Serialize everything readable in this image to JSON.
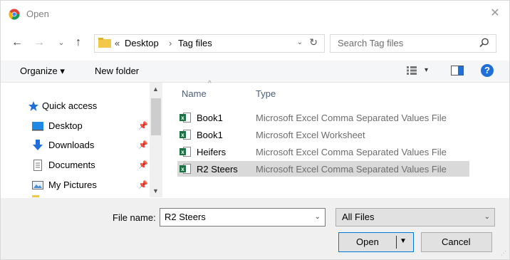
{
  "window": {
    "title": "Open",
    "close_glyph": "✕"
  },
  "nav": {
    "back": "←",
    "forward": "→",
    "recent": "⌄",
    "up": "↑"
  },
  "address": {
    "prefix": "«",
    "crumbs": [
      "Desktop",
      "Tag files"
    ],
    "separator": "›",
    "dropdown": "⌄",
    "refresh": "↻"
  },
  "search": {
    "placeholder": "Search Tag files"
  },
  "toolbar": {
    "organize": "Organize ▾",
    "new_folder": "New folder",
    "view_drop": "▾",
    "help": "?"
  },
  "sidebar": {
    "items": [
      {
        "label": "Quick access",
        "icon": "star-icon"
      },
      {
        "label": "Desktop",
        "icon": "desktop-icon",
        "pinned": true
      },
      {
        "label": "Downloads",
        "icon": "download-icon",
        "pinned": true
      },
      {
        "label": "Documents",
        "icon": "documents-icon",
        "pinned": true
      },
      {
        "label": "My Pictures",
        "icon": "pictures-icon",
        "pinned": true
      }
    ],
    "pin_glyph": "📌"
  },
  "filelist": {
    "columns": {
      "name": "Name",
      "type": "Type"
    },
    "rows": [
      {
        "name": "Book1",
        "type": "Microsoft Excel Comma Separated Values File",
        "selected": false
      },
      {
        "name": "Book1",
        "type": "Microsoft Excel Worksheet",
        "selected": false
      },
      {
        "name": "Heifers",
        "type": "Microsoft Excel Comma Separated Values File",
        "selected": false
      },
      {
        "name": "R2 Steers",
        "type": "Microsoft Excel Comma Separated Values File",
        "selected": true
      }
    ]
  },
  "footer": {
    "filename_label": "File name:",
    "filename_value": "R2 Steers",
    "filetype_value": "All Files",
    "open_label": "Open",
    "cancel_label": "Cancel"
  },
  "colors": {
    "accent": "#0078d7",
    "excel": "#1d7044",
    "folder": "#f3c848",
    "help": "#1e6fd9"
  }
}
